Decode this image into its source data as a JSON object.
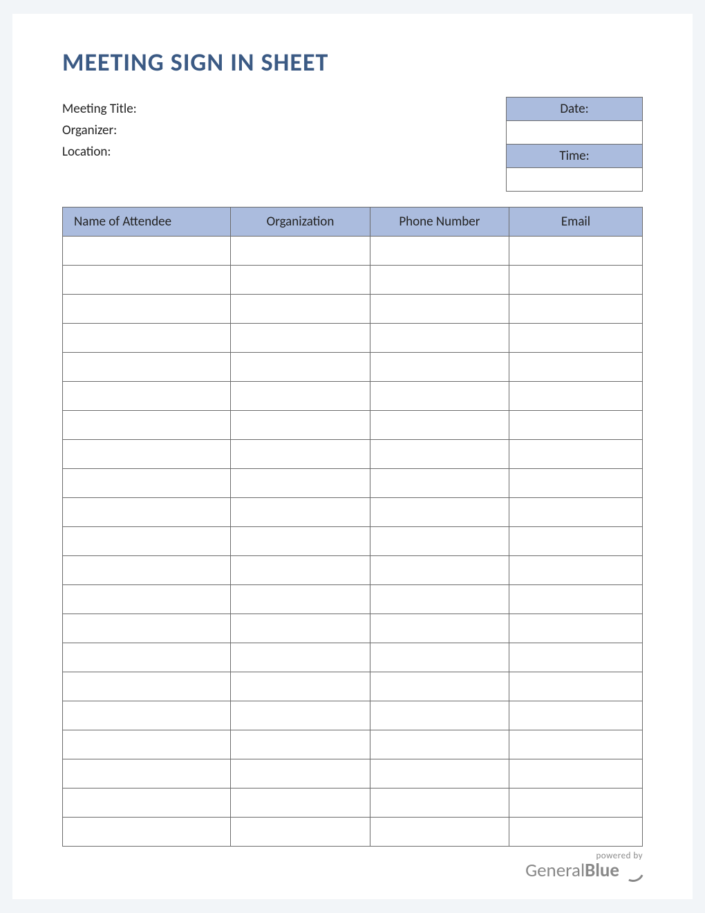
{
  "title": "MEETING SIGN IN SHEET",
  "meta": {
    "meeting_title_label": "Meeting Title:",
    "organizer_label": "Organizer:",
    "location_label": "Location:",
    "date_label": "Date:",
    "date_value": "",
    "time_label": "Time:",
    "time_value": ""
  },
  "columns": {
    "name": "Name of Attendee",
    "organization": "Organization",
    "phone": "Phone Number",
    "email": "Email"
  },
  "row_count": 21,
  "footer": {
    "powered_by": "powered by",
    "logo_general": "General",
    "logo_blue": "Blue"
  },
  "colors": {
    "header_bg": "#abbcde",
    "title_color": "#3b5a84",
    "border": "#6b6b6b"
  }
}
